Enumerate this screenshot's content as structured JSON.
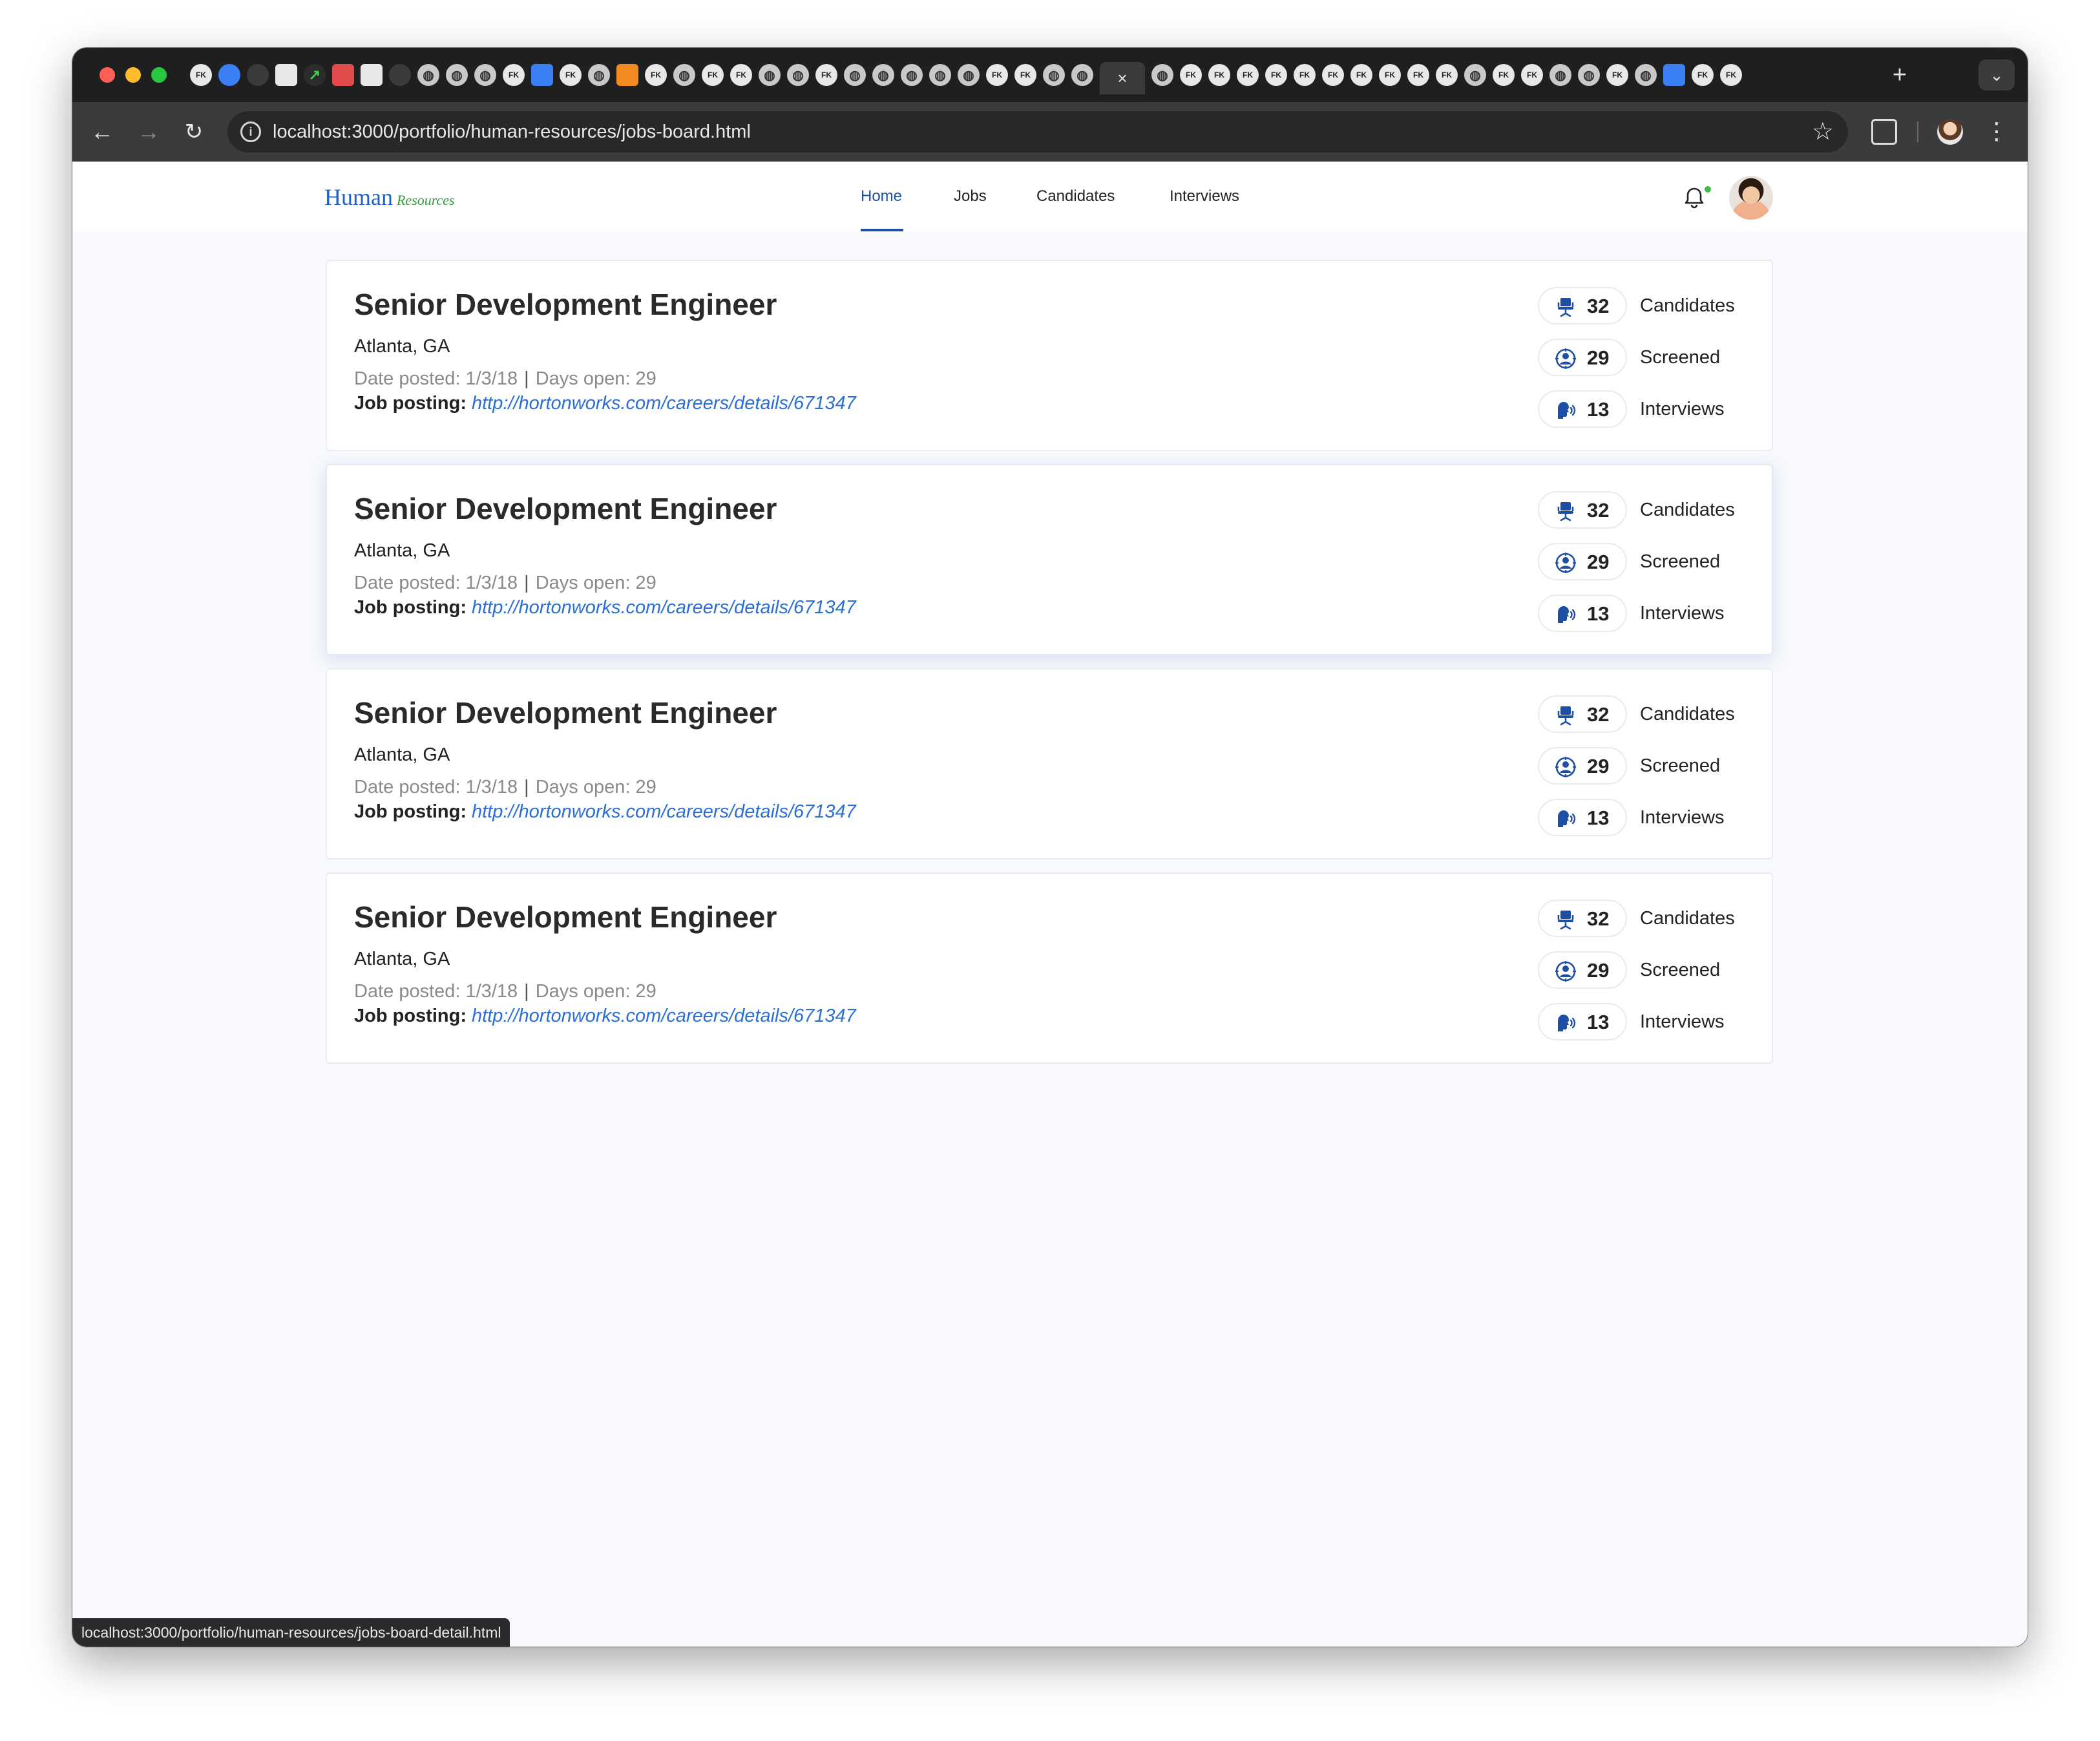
{
  "browser": {
    "url": "localhost:3000/portfolio/human-resources/jobs-board.html",
    "status_url": "localhost:3000/portfolio/human-resources/jobs-board-detail.html",
    "active_tab_close": "×",
    "new_tab": "+",
    "tab_menu": "⌄"
  },
  "header": {
    "logo_main": "Human",
    "logo_sub": "Resources",
    "nav": [
      {
        "label": "Home",
        "active": true
      },
      {
        "label": "Jobs",
        "active": false
      },
      {
        "label": "Candidates",
        "active": false
      },
      {
        "label": "Interviews",
        "active": false
      }
    ]
  },
  "jobs": [
    {
      "title": "Senior Development Engineer",
      "location": "Atlanta, GA",
      "date_posted": "Date posted: 1/3/18",
      "days_open": "Days open: 29",
      "posting_label": "Job posting:",
      "posting_url": "http://hortonworks.com/careers/details/671347",
      "stats": [
        {
          "icon": "chair-icon",
          "value": "32",
          "label": "Candidates"
        },
        {
          "icon": "person-screen-icon",
          "value": "29",
          "label": "Screened"
        },
        {
          "icon": "speaking-head-icon",
          "value": "13",
          "label": "Interviews"
        }
      ]
    },
    {
      "title": "Senior Development Engineer",
      "location": "Atlanta, GA",
      "date_posted": "Date posted: 1/3/18",
      "days_open": "Days open: 29",
      "posting_label": "Job posting:",
      "posting_url": "http://hortonworks.com/careers/details/671347",
      "stats": [
        {
          "icon": "chair-icon",
          "value": "32",
          "label": "Candidates"
        },
        {
          "icon": "person-screen-icon",
          "value": "29",
          "label": "Screened"
        },
        {
          "icon": "speaking-head-icon",
          "value": "13",
          "label": "Interviews"
        }
      ]
    },
    {
      "title": "Senior Development Engineer",
      "location": "Atlanta, GA",
      "date_posted": "Date posted: 1/3/18",
      "days_open": "Days open: 29",
      "posting_label": "Job posting:",
      "posting_url": "http://hortonworks.com/careers/details/671347",
      "stats": [
        {
          "icon": "chair-icon",
          "value": "32",
          "label": "Candidates"
        },
        {
          "icon": "person-screen-icon",
          "value": "29",
          "label": "Screened"
        },
        {
          "icon": "speaking-head-icon",
          "value": "13",
          "label": "Interviews"
        }
      ]
    },
    {
      "title": "Senior Development Engineer",
      "location": "Atlanta, GA",
      "date_posted": "Date posted: 1/3/18",
      "days_open": "Days open: 29",
      "posting_label": "Job posting:",
      "posting_url": "http://hortonworks.com/careers/details/671347",
      "stats": [
        {
          "icon": "chair-icon",
          "value": "32",
          "label": "Candidates"
        },
        {
          "icon": "person-screen-icon",
          "value": "29",
          "label": "Screened"
        },
        {
          "icon": "speaking-head-icon",
          "value": "13",
          "label": "Interviews"
        }
      ]
    }
  ]
}
